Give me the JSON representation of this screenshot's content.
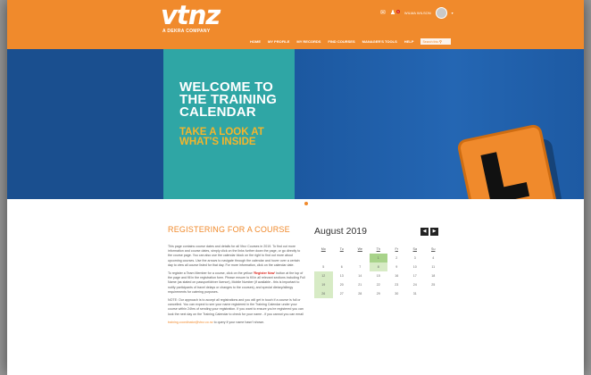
{
  "header": {
    "logo": "vtnz",
    "logo_sub": "A DEKRA COMPANY",
    "user_name": "WILMA WILSON",
    "notification_count": "1",
    "nav": [
      "HOME",
      "MY PROFILE",
      "MY RECORDS",
      "FIND COURSES",
      "MANAGER'S TOOLS",
      "HELP"
    ],
    "search_placeholder": "Search this"
  },
  "hero": {
    "welcome_lines": [
      "WELCOME TO",
      "THE TRAINING",
      "CALENDAR"
    ],
    "tagline_lines": [
      "TAKE A LOOK AT",
      "WHAT'S INSIDE"
    ]
  },
  "content": {
    "title": "REGISTERING FOR A COURSE",
    "p1": "This page contains course dates and details for all Vtnz Courses in 2019. To find out more information and course dates, simply click on the links further down the page, or go directly to the course page. You can also use the calendar block on the right to find out more about upcoming courses. Use the arrows to navigate through the calendar and hover over a certain day to view all course listed for that day. For more information, click on the calendar date.",
    "p2_before": "To register a Team Member for a course, click on the yellow ",
    "p2_em": "'Register Now'",
    "p2_after": " button at the top of the page and fill in the registration form. Please ensure to fill in all relevant sections including Full Name (as stated on passport/driver licence), Mobile Number (if available - this is important to notify participants of travel delays or changes to the courses), and special dietary/allergy requirements for catering purposes.",
    "p3": "NOTE: Our approach is to accept all registrations and you will get in touch if a course is full or cancelled. You can expect to see your name registered in the Training Calendar under your course within 24hrs of sending your registration. If you want to ensure you're registered you can look the next day on the Training Calendar to check for your name - if you cannot you can email",
    "p3_link": "training.coordinator@vtnz.co.nz",
    "p3_end": " to query if your name hasn't shown."
  },
  "calendar": {
    "month": "August 2019",
    "prev_icon": "chevron-left-icon",
    "next_icon": "chevron-right-icon",
    "weekdays": [
      "Mo",
      "Tu",
      "We",
      "Th",
      "Fr",
      "Sa",
      "Su"
    ],
    "weeks": [
      [
        "",
        "",
        "",
        "1",
        "2",
        "3",
        "4"
      ],
      [
        "5",
        "6",
        "7",
        "8",
        "9",
        "10",
        "11"
      ],
      [
        "12",
        "13",
        "14",
        "15",
        "16",
        "17",
        "18"
      ],
      [
        "19",
        "20",
        "21",
        "22",
        "23",
        "24",
        "25"
      ],
      [
        "26",
        "27",
        "28",
        "29",
        "30",
        "31",
        ""
      ]
    ]
  },
  "colors": {
    "brand_orange": "#f08a2c",
    "hero_blue": "#1d5aa3",
    "hero_teal": "#2fa6a5",
    "tagline_yellow": "#f5b52a"
  }
}
